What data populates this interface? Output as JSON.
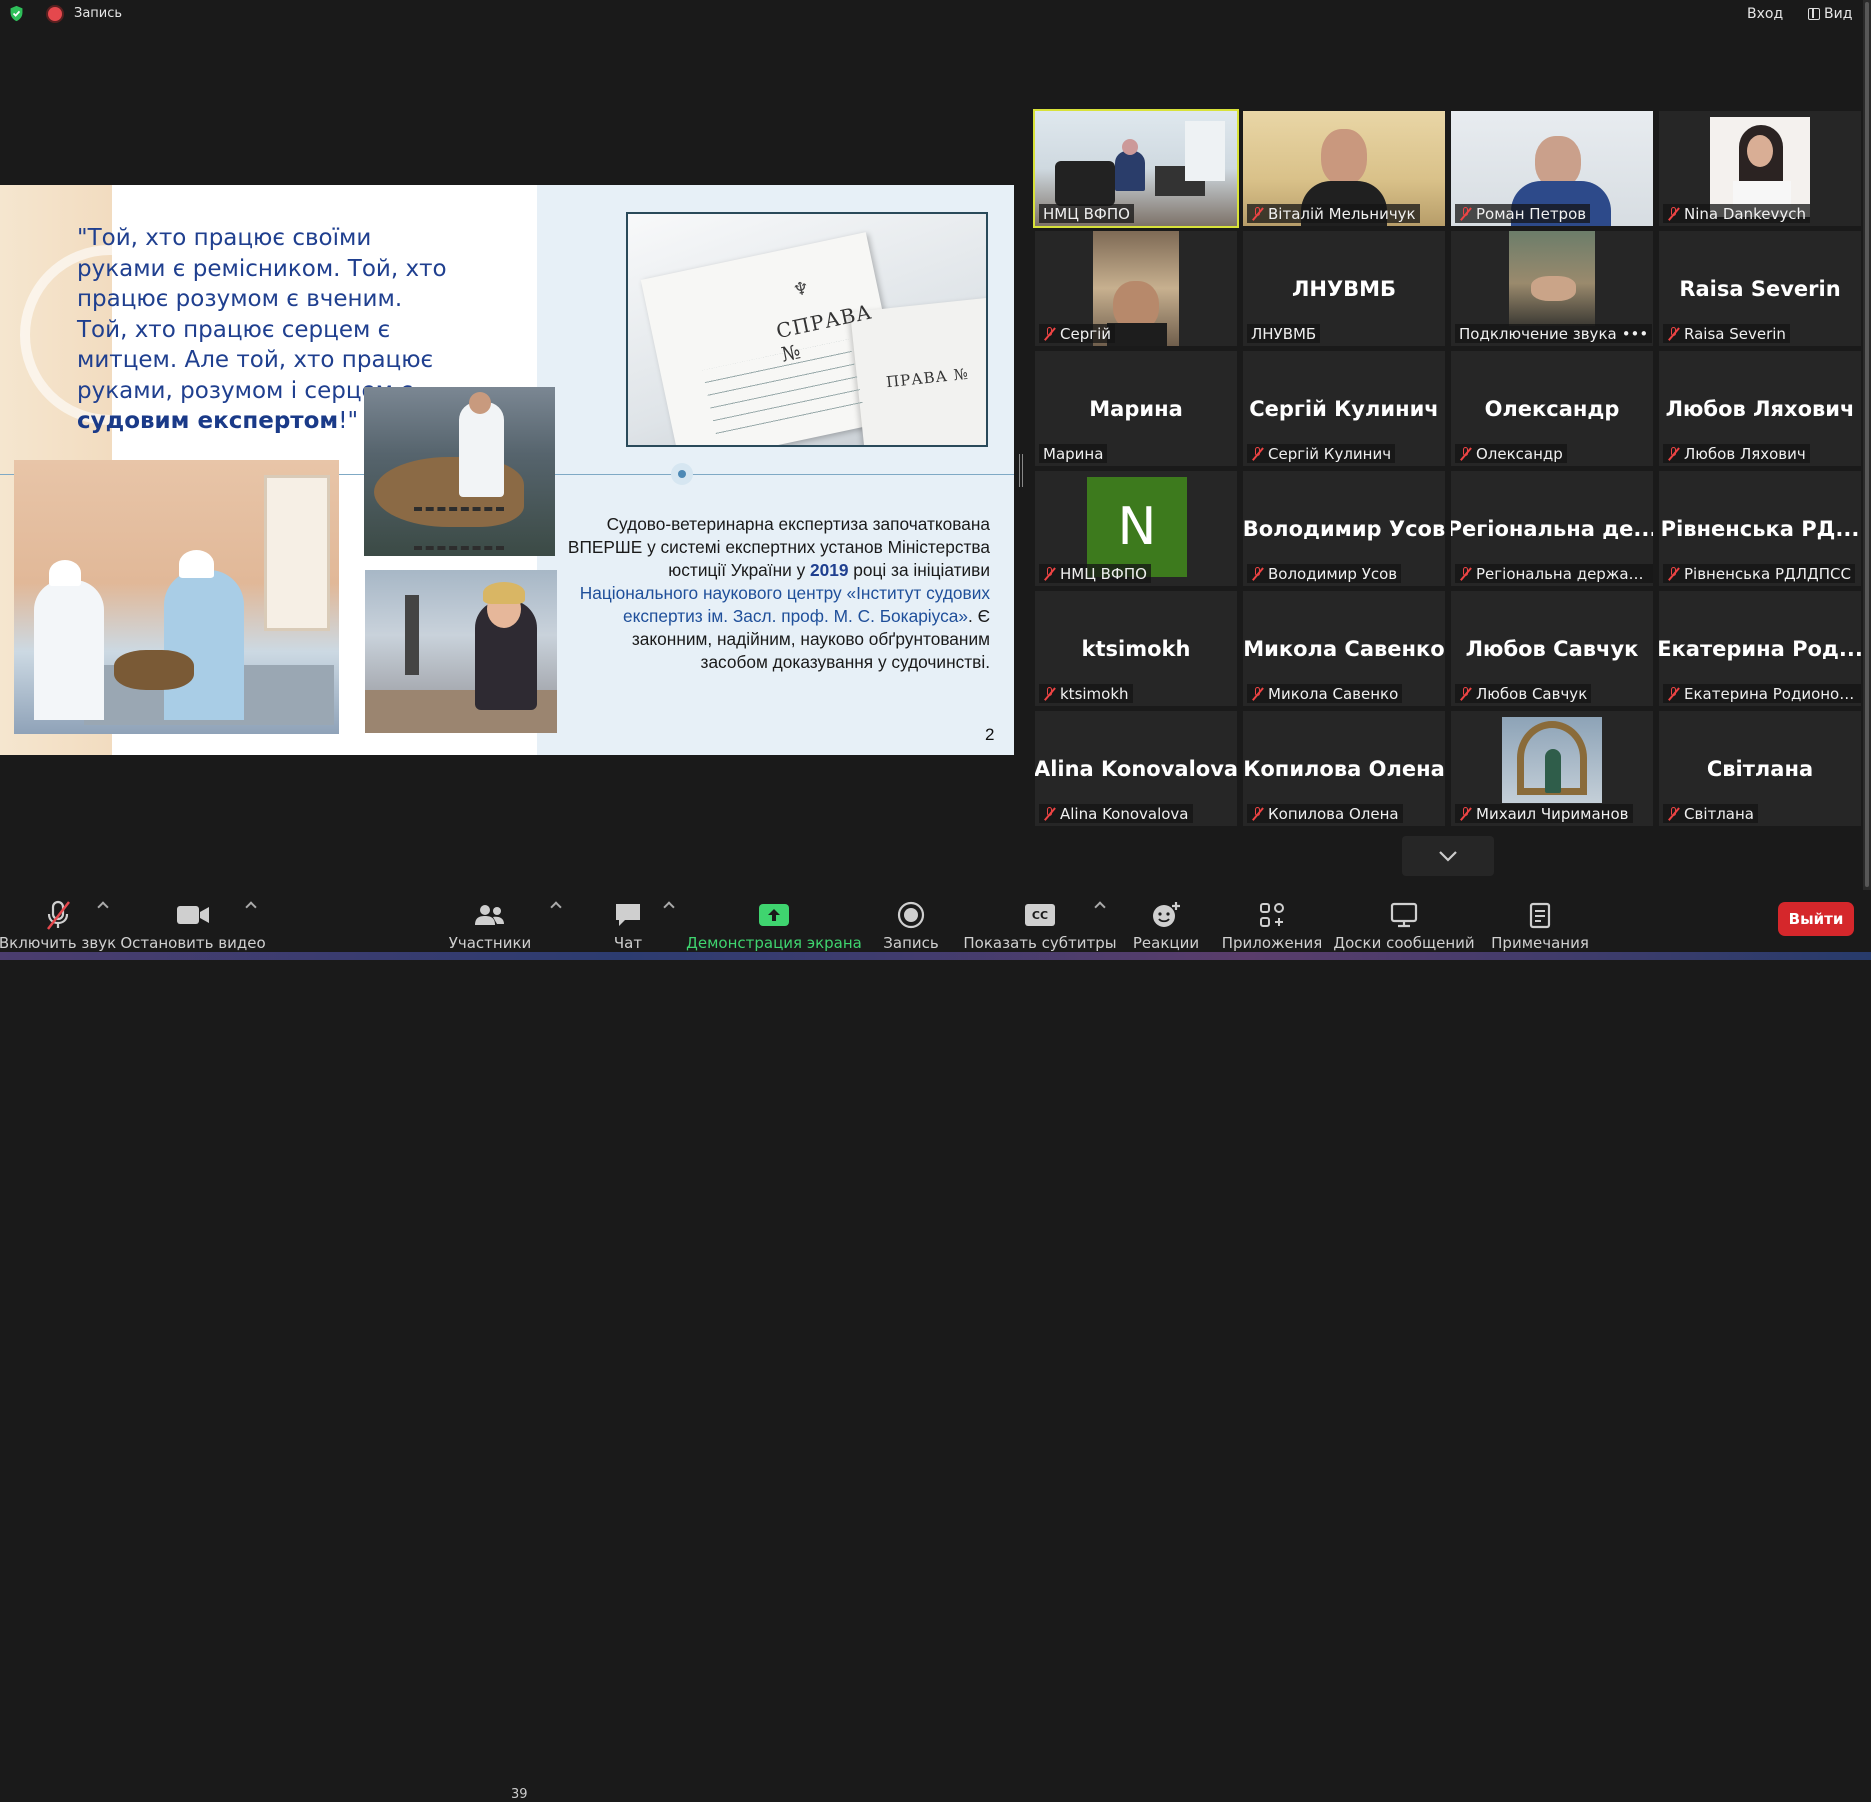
{
  "topbar": {
    "record_label": "Запись",
    "enter_label": "Вход",
    "view_label": "Вид"
  },
  "slide": {
    "quote_line1": "\"Той, хто працює своїми",
    "quote_line2": "руками є ремісником. Той, хто",
    "quote_line3": "працює розумом є вченим.",
    "quote_line4": "Той, хто працює серцем є",
    "quote_line5": "митцем. Але той, хто працює",
    "quote_line6": "руками, розумом і серцем є",
    "quote_bold": "судовим експертом",
    "quote_end": "!\"",
    "doc_title_1": "СПРАВА",
    "doc_num": "№",
    "doc_title_2": "ПРАВА  №",
    "text_part1": "Судово-ветеринарна експертиза започаткована ВПЕРШЕ у системі експертних установ Міністерства юстиції України у ",
    "text_year": "2019",
    "text_part2": " році за ініціативи ",
    "text_blue": "Національного наукового центру «Інститут судових експертиз ім. Засл. проф. М. С. Бокаріуса»",
    "text_part3": ". Є законним, надійним, науково обґрунтованим засобом доказування у судочинстві.",
    "page_number": "2"
  },
  "participants": [
    {
      "big": "",
      "name": "НМЦ ВФПО",
      "muted": false,
      "video": "office",
      "active": true
    },
    {
      "big": "",
      "name": "Віталій Мельничук",
      "muted": true,
      "video": "man1"
    },
    {
      "big": "",
      "name": "Роман Петров",
      "muted": true,
      "video": "man2"
    },
    {
      "big": "",
      "name": "Nina Dankevych",
      "muted": true,
      "video": "woman"
    },
    {
      "big": "",
      "name": "Сергій",
      "muted": true,
      "video": "man3"
    },
    {
      "big": "ЛНУВМБ",
      "name": "ЛНУВМБ",
      "muted": false
    },
    {
      "big": "",
      "name": "Подключение звука",
      "muted": false,
      "video": "hand",
      "dots": "•••"
    },
    {
      "big": "Raisa Severin",
      "name": "Raisa Severin",
      "muted": true
    },
    {
      "big": "Марина",
      "name": "Марина",
      "muted": false
    },
    {
      "big": "Сергій Кулинич",
      "name": "Сергій Кулинич",
      "muted": true
    },
    {
      "big": "Олександр",
      "name": "Олександр",
      "muted": true
    },
    {
      "big": "Любов Ляхович",
      "name": "Любов Ляхович",
      "muted": true
    },
    {
      "big": "",
      "name": "НМЦ ВФПО",
      "muted": true,
      "avatar": "N"
    },
    {
      "big": "Володимир Усов",
      "name": "Володимир Усов",
      "muted": true
    },
    {
      "big": "Регіональна де...",
      "name": "Регіональна державн...",
      "muted": true
    },
    {
      "big": "Рівненська РД...",
      "name": "Рівненська РДЛДПСС",
      "muted": true
    },
    {
      "big": "ktsimokh",
      "name": "ktsimokh",
      "muted": true
    },
    {
      "big": "Микола Савенко",
      "name": "Микола Савенко",
      "muted": true
    },
    {
      "big": "Любов Савчук",
      "name": "Любов Савчук",
      "muted": true
    },
    {
      "big": "Екатерина Род...",
      "name": "Екатерина Родионова",
      "muted": true
    },
    {
      "big": "Alina Konovalova",
      "name": "Alina Konovalova",
      "muted": true
    },
    {
      "big": "Копилова Олена",
      "name": "Копилова Олена",
      "muted": true
    },
    {
      "big": "",
      "name": "Михаил Чириманов",
      "muted": true,
      "video": "arch"
    },
    {
      "big": "Світлана",
      "name": "Світлана",
      "muted": true
    }
  ],
  "toolbar": {
    "unmute": "Включить звук",
    "stop_video": "Остановить видео",
    "participants": "Участники",
    "participants_count": "39",
    "chat": "Чат",
    "share": "Демонстрация экрана",
    "record": "Запись",
    "captions": "Показать субтитры",
    "cc": "CC",
    "reactions": "Реакции",
    "apps": "Приложения",
    "whiteboards": "Доски сообщений",
    "notes": "Примечания",
    "leave": "Выйти"
  },
  "colors": {
    "accent_green": "#3fd46f",
    "leave_red": "#d5272b",
    "active_border": "#d8e23a",
    "slide_blue": "#1f3f8f"
  }
}
